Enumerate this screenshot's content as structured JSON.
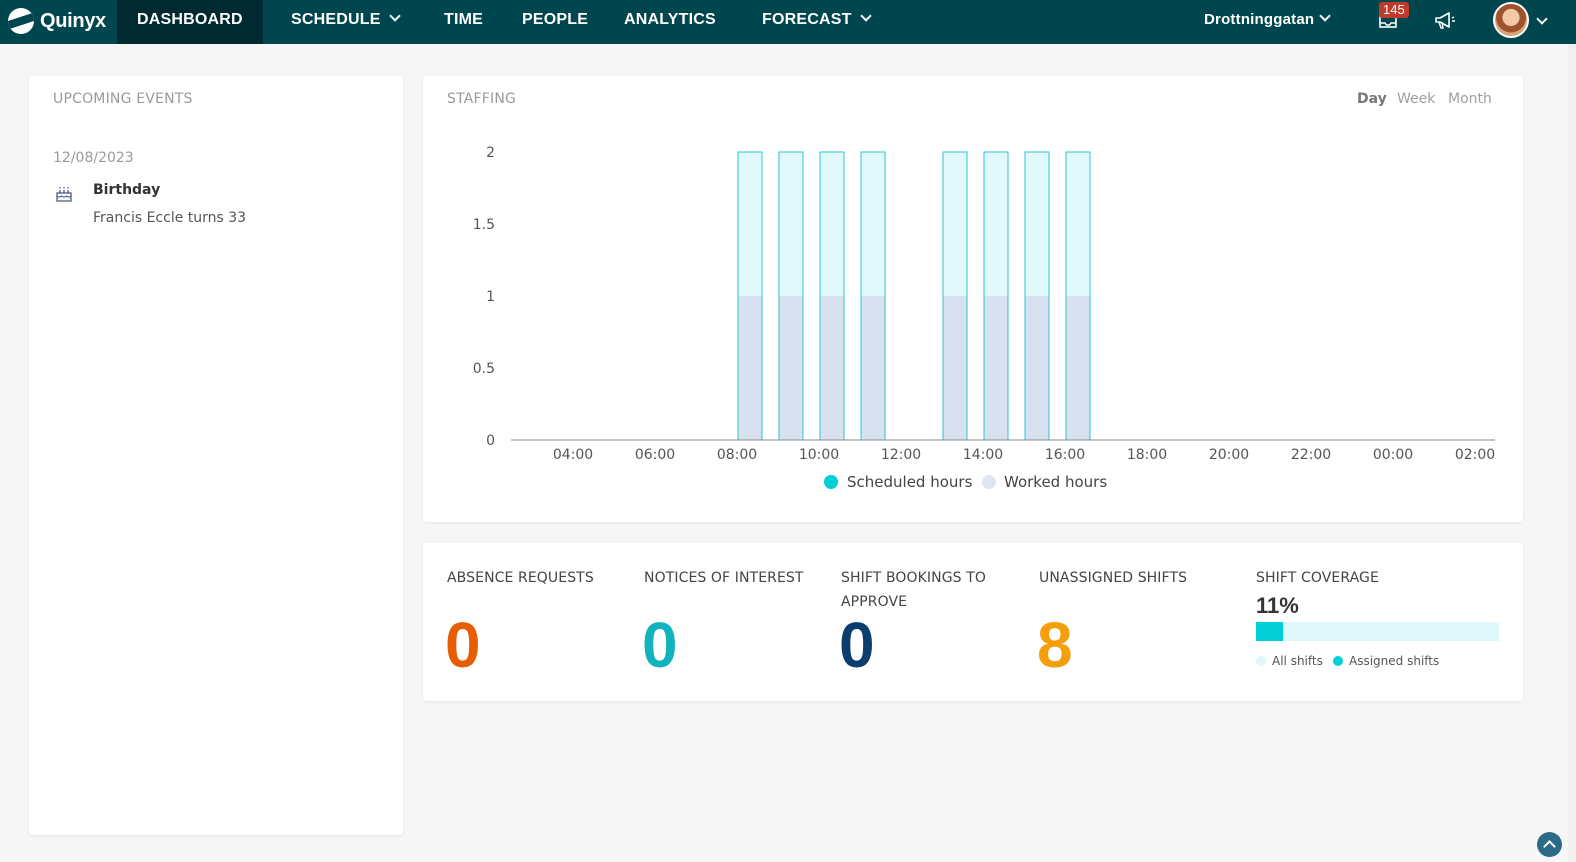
{
  "app": {
    "logo_text": "Quinyx"
  },
  "nav": {
    "items": [
      {
        "label": "DASHBOARD",
        "active": true,
        "dropdown": false
      },
      {
        "label": "SCHEDULE",
        "active": false,
        "dropdown": true
      },
      {
        "label": "TIME",
        "active": false,
        "dropdown": false
      },
      {
        "label": "PEOPLE",
        "active": false,
        "dropdown": false
      },
      {
        "label": "ANALYTICS",
        "active": false,
        "dropdown": false
      },
      {
        "label": "FORECAST",
        "active": false,
        "dropdown": true
      }
    ],
    "unit": "Drottninggatan",
    "notifications_count": "145",
    "icons": {
      "messages": "inbox-icon",
      "announcements": "megaphone-icon",
      "user": "avatar"
    }
  },
  "events": {
    "title": "UPCOMING EVENTS",
    "items": [
      {
        "date": "12/08/2023",
        "type": "Birthday",
        "description": "Francis Eccle turns 33",
        "icon": "cake-icon"
      }
    ]
  },
  "staffing": {
    "title": "STAFFING",
    "periods": [
      {
        "label": "Day",
        "active": true
      },
      {
        "label": "Week",
        "active": false
      },
      {
        "label": "Month",
        "active": false
      }
    ]
  },
  "chart_data": {
    "type": "bar",
    "title": "STAFFING",
    "x_tick_labels": [
      "04:00",
      "06:00",
      "08:00",
      "10:00",
      "12:00",
      "14:00",
      "16:00",
      "18:00",
      "20:00",
      "22:00",
      "00:00",
      "02:00"
    ],
    "y_tick_labels": [
      "0",
      "0.5",
      "1",
      "1.5",
      "2"
    ],
    "ylim": [
      0,
      2
    ],
    "x_hours": [
      8,
      9,
      10,
      11,
      13,
      14,
      15,
      16
    ],
    "series": [
      {
        "name": "Scheduled hours",
        "color": "#00cfd6",
        "values": [
          2,
          2,
          2,
          2,
          2,
          2,
          2,
          2
        ]
      },
      {
        "name": "Worked hours",
        "color": "#e0e6ef",
        "values": [
          1,
          1,
          1,
          1,
          1,
          1,
          1,
          1
        ]
      }
    ],
    "legend": "bottom",
    "grid": false
  },
  "stats": {
    "absence": {
      "label": "ABSENCE REQUESTS",
      "value": "0",
      "color": "#e85d04"
    },
    "notices": {
      "label": "NOTICES OF INTEREST",
      "value": "0",
      "color": "#12b3bd"
    },
    "bookings": {
      "label_line1": "SHIFT BOOKINGS TO",
      "label_line2": "APPROVE",
      "value": "0",
      "color": "#0b3e6e"
    },
    "unassigned": {
      "label": "UNASSIGNED SHIFTS",
      "value": "8",
      "color": "#f59e0b"
    },
    "coverage": {
      "label": "SHIFT COVERAGE",
      "value": "11%",
      "fraction": 0.11,
      "legend_all": "All shifts",
      "legend_assigned": "Assigned shifts"
    }
  }
}
